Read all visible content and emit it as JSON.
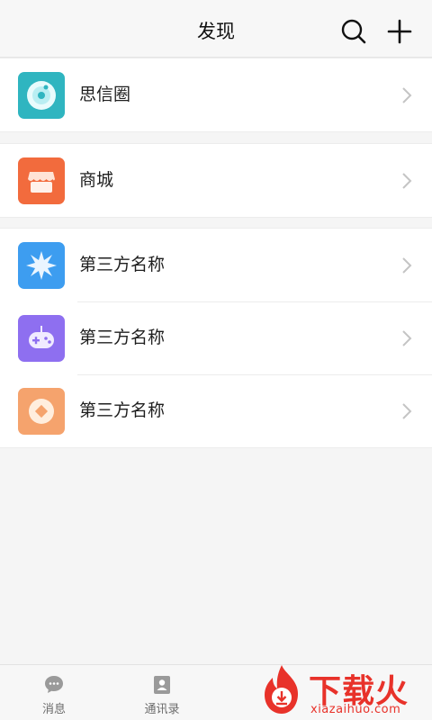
{
  "header": {
    "title": "发现",
    "search_icon": "search-icon",
    "add_icon": "plus-icon"
  },
  "sections": [
    {
      "items": [
        {
          "label": "思信圈",
          "icon": "moments-disc-icon",
          "color": "#2fb5c0"
        }
      ]
    },
    {
      "items": [
        {
          "label": "商城",
          "icon": "shop-icon",
          "color": "#f26b3d"
        }
      ]
    },
    {
      "items": [
        {
          "label": "第三方名称",
          "icon": "starburst-icon",
          "color": "#3d9df0"
        },
        {
          "label": "第三方名称",
          "icon": "gamepad-icon",
          "color": "#8e6ff0"
        },
        {
          "label": "第三方名称",
          "icon": "coin-icon",
          "color": "#f5a36d"
        }
      ]
    }
  ],
  "tabbar": {
    "tabs": [
      {
        "label": "消息",
        "icon": "chat-bubble-icon"
      },
      {
        "label": "通讯录",
        "icon": "contacts-icon"
      }
    ]
  },
  "watermark": {
    "title": "下载火",
    "url": "xiazaihuo.com",
    "color": "#e8322a"
  }
}
